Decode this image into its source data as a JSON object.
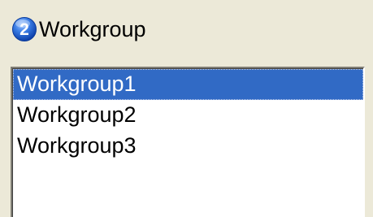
{
  "header": {
    "title": "Workgroup",
    "icon": "step-2-icon",
    "icon_number": "2",
    "icon_color": "#1c5fcf"
  },
  "listbox": {
    "items": [
      {
        "label": "Workgroup1",
        "selected": true
      },
      {
        "label": "Workgroup2",
        "selected": false
      },
      {
        "label": "Workgroup3",
        "selected": false
      }
    ],
    "selection_color": "#316ac5"
  }
}
